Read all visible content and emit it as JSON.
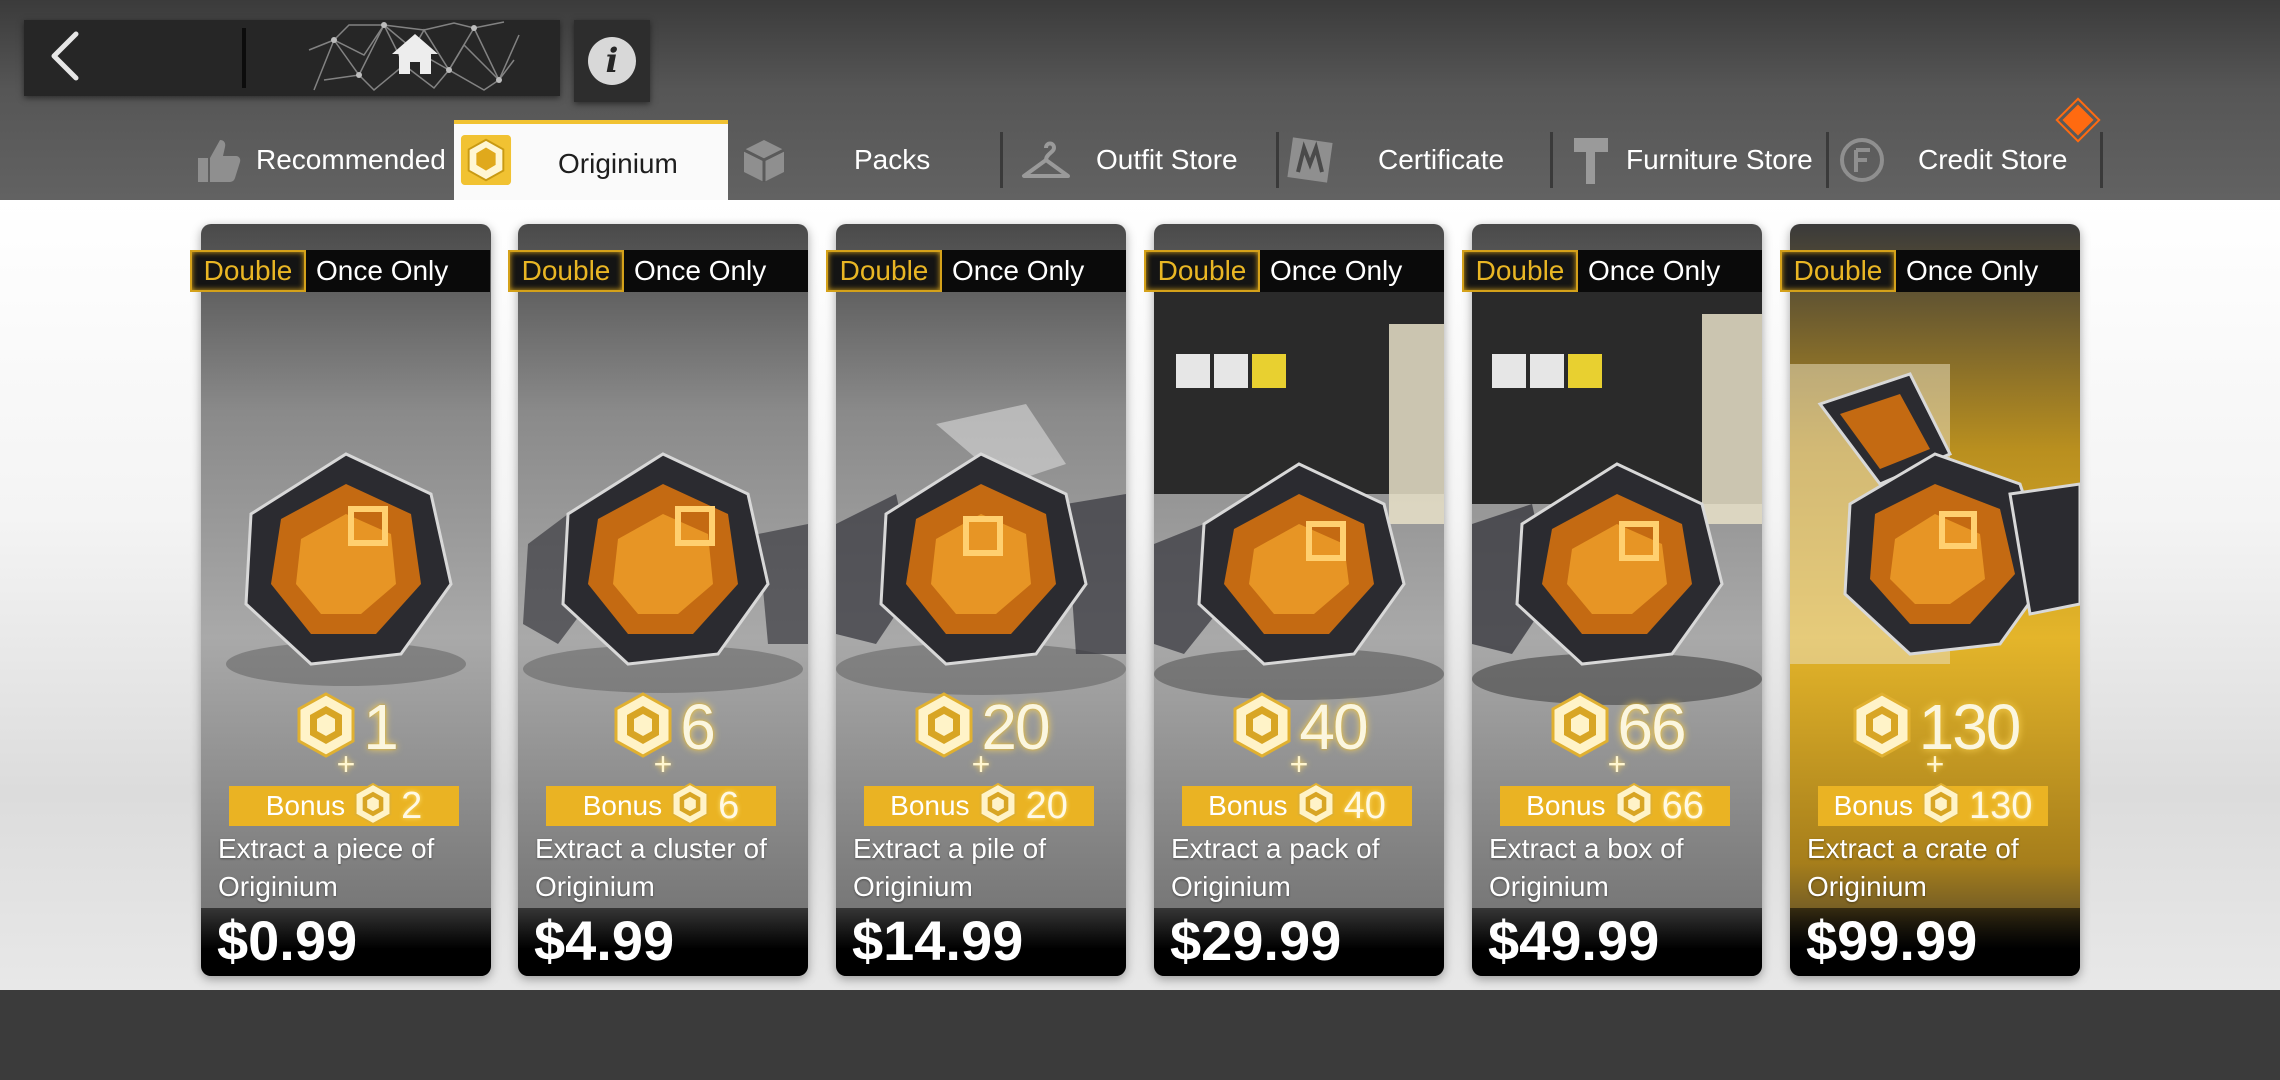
{
  "header": {
    "icons": {
      "back": "chevron-left-icon",
      "home": "home-icon",
      "info": "info-icon"
    },
    "info_glyph": "i"
  },
  "tabs": [
    {
      "id": "recommended",
      "label": "Recommended",
      "icon": "thumbs-up-icon",
      "active": false
    },
    {
      "id": "originium",
      "label": "Originium",
      "icon": "originium-icon",
      "active": true
    },
    {
      "id": "packs",
      "label": "Packs",
      "icon": "package-icon",
      "active": false
    },
    {
      "id": "outfit-store",
      "label": "Outfit Store",
      "icon": "hanger-icon",
      "active": false
    },
    {
      "id": "certificate",
      "label": "Certificate",
      "icon": "certificate-icon",
      "active": false
    },
    {
      "id": "furniture-store",
      "label": "Furniture Store",
      "icon": "hammer-icon",
      "active": false
    },
    {
      "id": "credit-store",
      "label": "Credit Store",
      "icon": "credit-coin-icon",
      "active": false
    }
  ],
  "products": [
    {
      "badge_double": "Double",
      "badge_once": "Once Only",
      "amount": "1",
      "plus": "+",
      "bonus_label": "Bonus",
      "bonus": "2",
      "desc_line1": "Extract a piece of",
      "desc_line2": "Originium",
      "price": "$0.99"
    },
    {
      "badge_double": "Double",
      "badge_once": "Once Only",
      "amount": "6",
      "plus": "+",
      "bonus_label": "Bonus",
      "bonus": "6",
      "desc_line1": "Extract a cluster of",
      "desc_line2": "Originium",
      "price": "$4.99"
    },
    {
      "badge_double": "Double",
      "badge_once": "Once Only",
      "amount": "20",
      "plus": "+",
      "bonus_label": "Bonus",
      "bonus": "20",
      "desc_line1": "Extract a pile of",
      "desc_line2": "Originium",
      "price": "$14.99"
    },
    {
      "badge_double": "Double",
      "badge_once": "Once Only",
      "amount": "40",
      "plus": "+",
      "bonus_label": "Bonus",
      "bonus": "40",
      "desc_line1": "Extract a pack of",
      "desc_line2": "Originium",
      "price": "$29.99"
    },
    {
      "badge_double": "Double",
      "badge_once": "Once Only",
      "amount": "66",
      "plus": "+",
      "bonus_label": "Bonus",
      "bonus": "66",
      "desc_line1": "Extract a box of",
      "desc_line2": "Originium",
      "price": "$49.99"
    },
    {
      "badge_double": "Double",
      "badge_once": "Once Only",
      "amount": "130",
      "plus": "+",
      "bonus_label": "Bonus",
      "bonus": "130",
      "desc_line1": "Extract a crate of",
      "desc_line2": "Originium",
      "price": "$99.99"
    }
  ],
  "colors": {
    "accent_gold": "#eab323",
    "notification": "#ff6a10",
    "tab_active_bg": "#fafafa"
  }
}
